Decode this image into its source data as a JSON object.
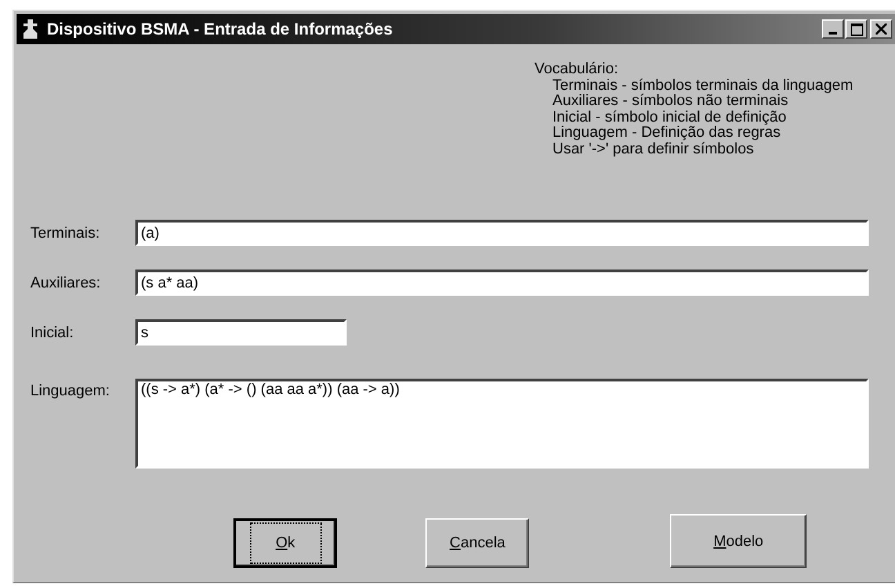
{
  "window": {
    "title": "Dispositivo BSMA - Entrada de Informações"
  },
  "vocabulary": {
    "heading": "Vocabulário:",
    "lines": [
      "Terminais - símbolos terminais da linguagem",
      "Auxiliares - símbolos não terminais",
      "Inicial - símbolo inicial de definição",
      "Linguagem - Definição das regras",
      "Usar '->' para definir símbolos"
    ]
  },
  "fields": [
    {
      "label": "Terminais:",
      "value": "(a)",
      "kind": "wide"
    },
    {
      "label": "Auxiliares:",
      "value": "(s a* aa)",
      "kind": "wide"
    },
    {
      "label": "Inicial:",
      "value": "s",
      "kind": "short"
    },
    {
      "label": "Linguagem:",
      "value": "((s -> a*) (a* -> () (aa aa a*)) (aa -> a))",
      "kind": "multiline"
    }
  ],
  "buttons": [
    {
      "mnemonic": "O",
      "rest": "k",
      "default": true
    },
    {
      "mnemonic": "C",
      "rest": "ancela",
      "default": false
    },
    {
      "mnemonic": "M",
      "rest": "odelo",
      "default": false
    }
  ]
}
